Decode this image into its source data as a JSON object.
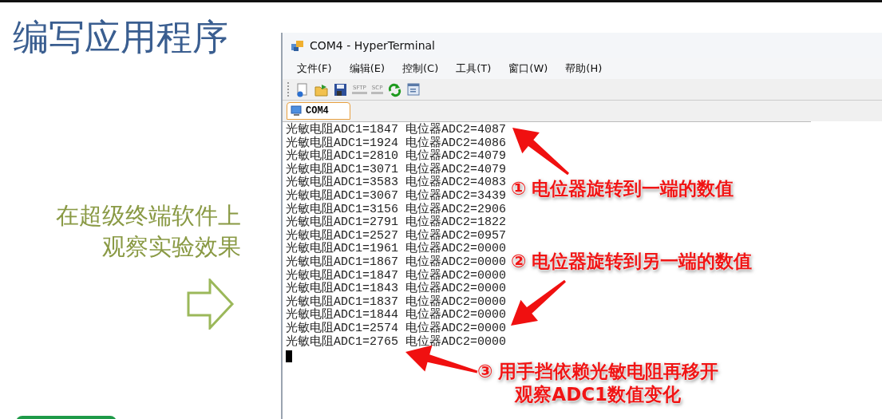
{
  "slide": {
    "title": "编写应用程序",
    "caption_lines": [
      "在超级终端软件上",
      "观察实验效果"
    ]
  },
  "window": {
    "title": "COM4 - HyperTerminal"
  },
  "menu": [
    "文件(F)",
    "编辑(E)",
    "控制(C)",
    "工具(T)",
    "窗口(W)",
    "帮助(H)"
  ],
  "toolbar": [
    {
      "kind": "new"
    },
    {
      "kind": "open"
    },
    {
      "kind": "save"
    },
    {
      "kind": "label",
      "label": "SFTP"
    },
    {
      "kind": "label",
      "label": "SCP"
    },
    {
      "kind": "reconnect"
    },
    {
      "kind": "properties"
    }
  ],
  "tabs": [
    {
      "label": "COM4",
      "selected": true
    }
  ],
  "terminal_lines": [
    "光敏电阻ADC1=1847 电位器ADC2=4087",
    "光敏电阻ADC1=1924 电位器ADC2=4086",
    "光敏电阻ADC1=2810 电位器ADC2=4079",
    "光敏电阻ADC1=3071 电位器ADC2=4079",
    "光敏电阻ADC1=3583 电位器ADC2=4083",
    "光敏电阻ADC1=3067 电位器ADC2=3439",
    "光敏电阻ADC1=3156 电位器ADC2=2906",
    "光敏电阻ADC1=2791 电位器ADC2=1822",
    "光敏电阻ADC1=2527 电位器ADC2=0957",
    "光敏电阻ADC1=1961 电位器ADC2=0000",
    "光敏电阻ADC1=1867 电位器ADC2=0000",
    "光敏电阻ADC1=1847 电位器ADC2=0000",
    "光敏电阻ADC1=1843 电位器ADC2=0000",
    "光敏电阻ADC1=1837 电位器ADC2=0000",
    "光敏电阻ADC1=1844 电位器ADC2=0000",
    "光敏电阻ADC1=2574 电位器ADC2=0000",
    "光敏电阻ADC1=2765 电位器ADC2=0000"
  ],
  "annotations": [
    {
      "number": "①",
      "lines": [
        "电位器旋转到一端的数值"
      ]
    },
    {
      "number": "②",
      "lines": [
        "电位器旋转到另一端的数值"
      ]
    },
    {
      "number": "③",
      "lines": [
        "用手挡依赖光敏电阻再移开",
        "观察ADC1数值变化"
      ]
    }
  ]
}
